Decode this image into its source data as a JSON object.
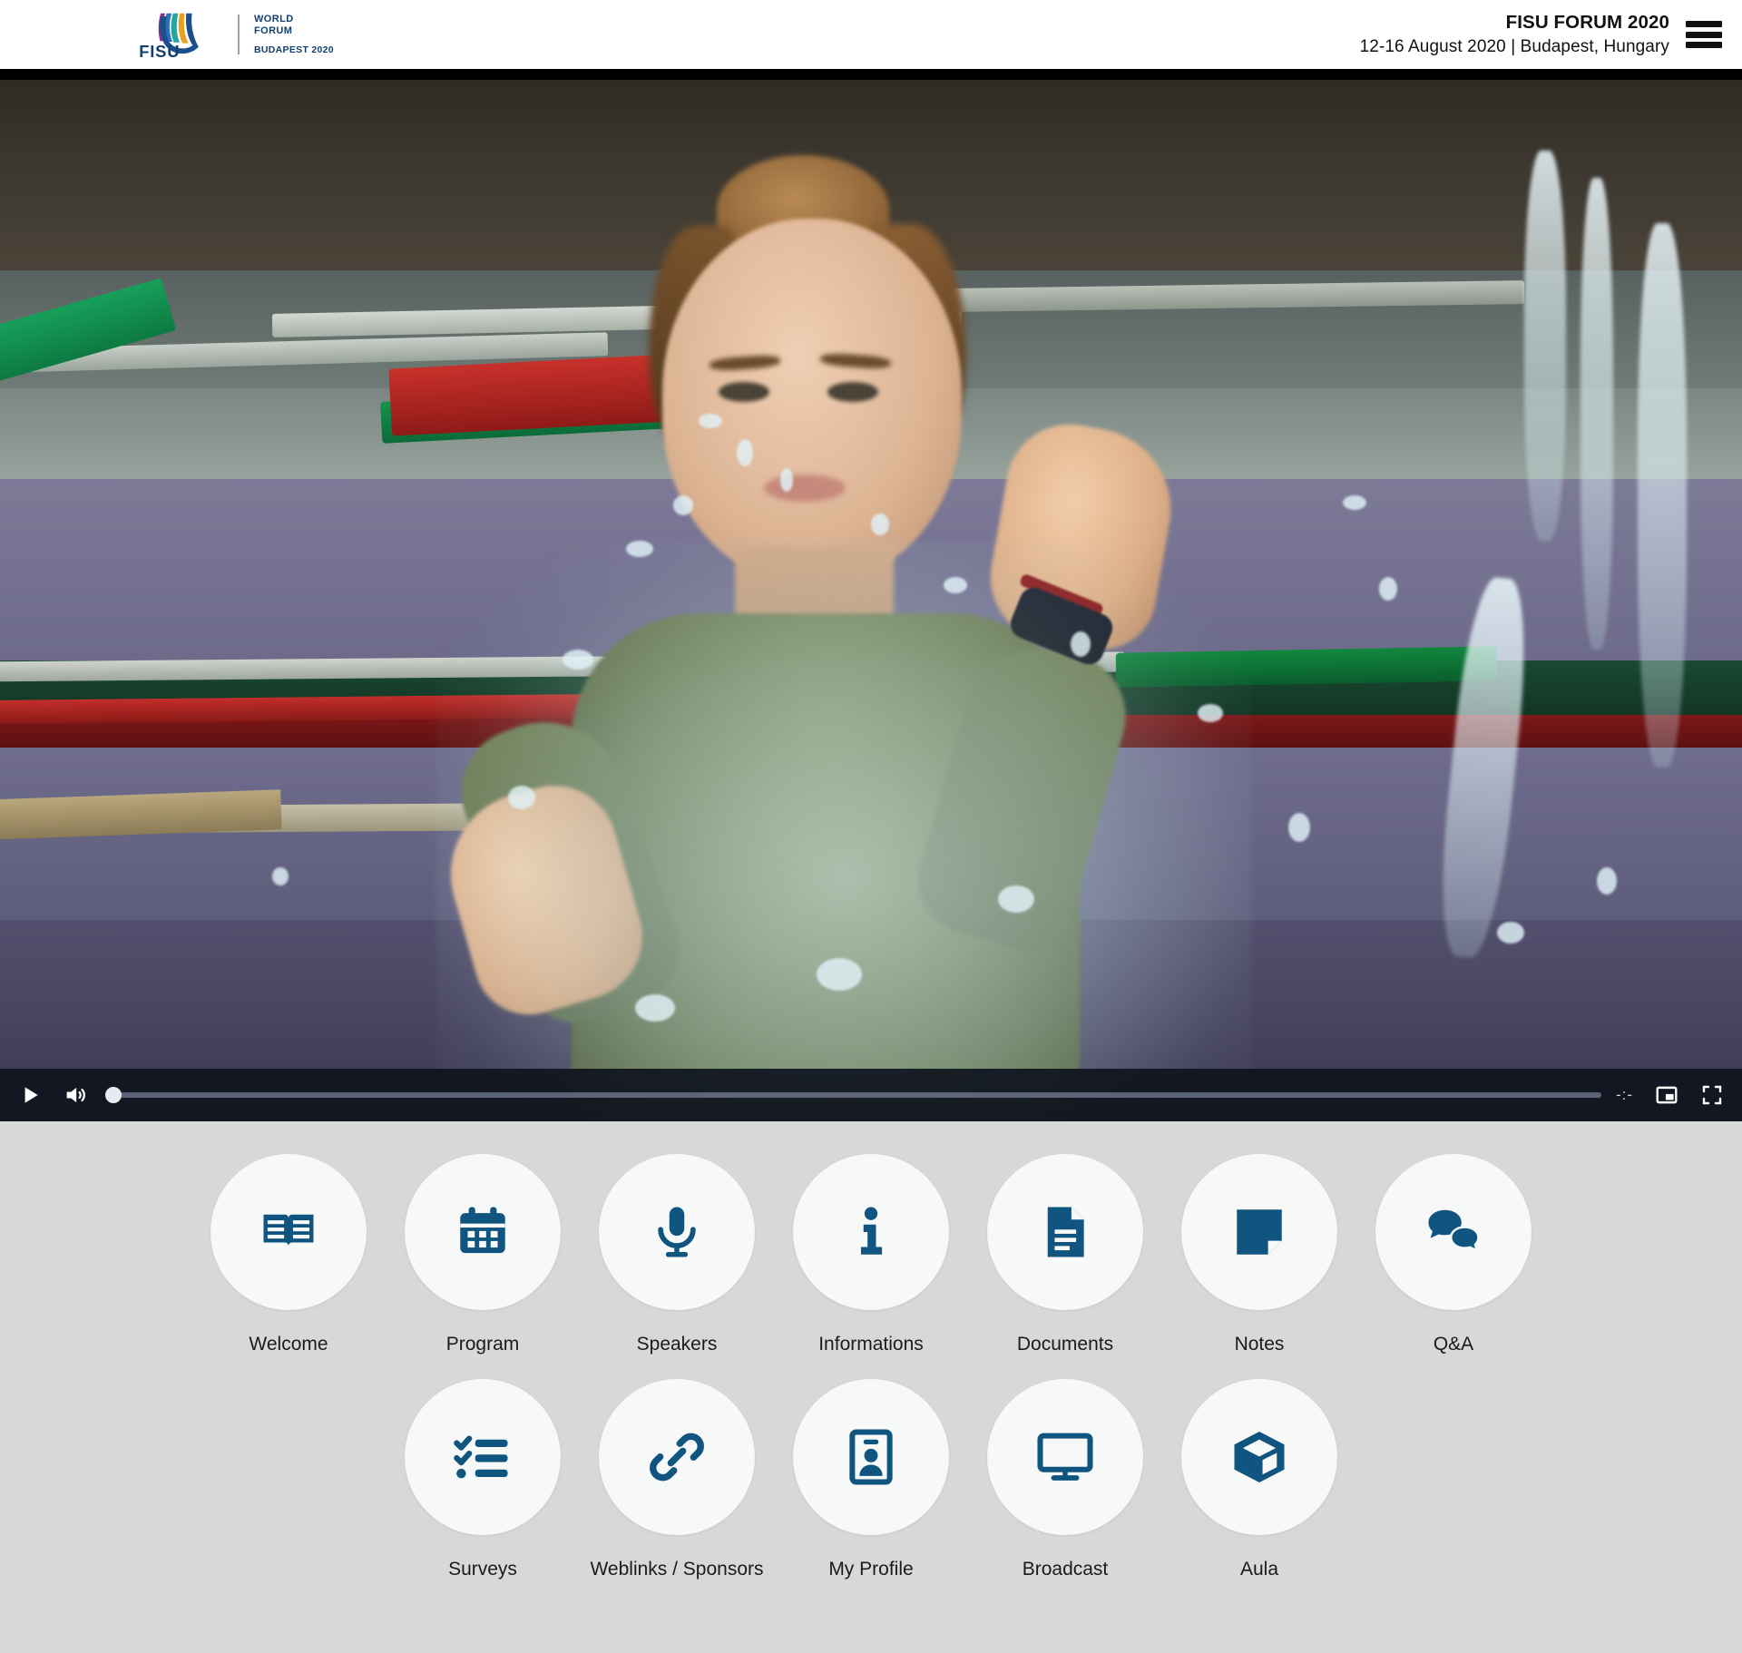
{
  "header": {
    "logo": {
      "name": "fisu-logo",
      "wordmark": "FISU",
      "line1": "WORLD",
      "line2": "FORUM",
      "line3": "BUDAPEST 2020"
    },
    "event_title": "FISU FORUM 2020",
    "event_meta": "12-16 August 2020 | Budapest, Hungary",
    "menu_icon": "hamburger-menu-icon",
    "background": "#ffffff",
    "brand_color": "#13406e"
  },
  "video": {
    "name": "conference-video-player",
    "state": "paused",
    "scene_description": "Woman in green sweater being splashed with water in a gymnasium",
    "controls": {
      "play_label": "Play",
      "play_icon": "play-icon",
      "volume_icon": "volume-icon",
      "progress_percent": 0,
      "time_display": "-:-",
      "pip_icon": "picture-in-picture-icon",
      "fullscreen_icon": "fullscreen-icon",
      "bar_background": "#101428"
    }
  },
  "app_grid": {
    "background": "#d8d8d8",
    "circle_color": "#f7f8f8",
    "icon_color": "#10557f",
    "rows": [
      [
        {
          "label": "Welcome",
          "icon": "open-book-icon"
        },
        {
          "label": "Program",
          "icon": "calendar-icon"
        },
        {
          "label": "Speakers",
          "icon": "microphone-icon"
        },
        {
          "label": "Informations",
          "icon": "info-icon"
        },
        {
          "label": "Documents",
          "icon": "document-icon"
        },
        {
          "label": "Notes",
          "icon": "sticky-note-icon"
        },
        {
          "label": "Q&A",
          "icon": "chat-bubbles-icon"
        }
      ],
      [
        {
          "label": "Surveys",
          "icon": "checklist-icon"
        },
        {
          "label": "Weblinks / Sponsors",
          "icon": "chain-link-icon"
        },
        {
          "label": "My Profile",
          "icon": "id-card-icon"
        },
        {
          "label": "Broadcast",
          "icon": "monitor-icon"
        },
        {
          "label": "Aula",
          "icon": "cube-icon"
        }
      ]
    ]
  }
}
